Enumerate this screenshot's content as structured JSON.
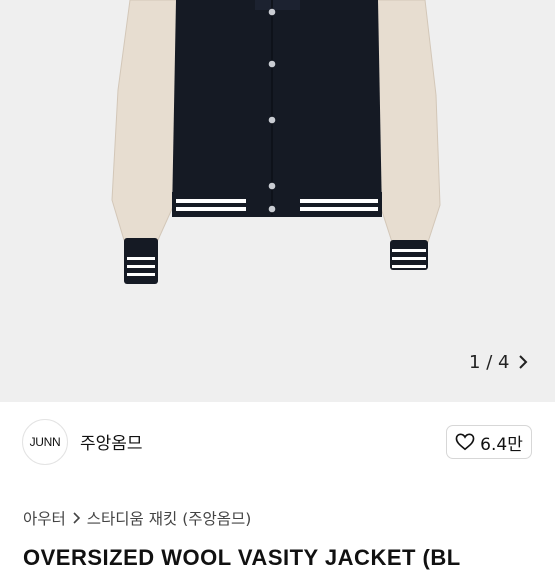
{
  "gallery": {
    "pager": {
      "current": "1",
      "separator": "/",
      "total": "4"
    }
  },
  "seller": {
    "logo_text": "JUNN",
    "name": "주앙옴므",
    "likes": "6.4만"
  },
  "breadcrumb": {
    "category": "아우터",
    "subcategory": "스타디움 재킷 (주앙옴므)"
  },
  "product": {
    "title": "OVERSIZED WOOL VASITY JACKET (BL"
  },
  "colors": {
    "background": "#ffffff",
    "gallery_bg": "#efefef",
    "jacket_body": "#151a24",
    "jacket_sleeve": "#e7ddd0"
  },
  "icons": {
    "pager_next": "chevron-right-icon",
    "like": "heart-outline-icon",
    "breadcrumb_separator": "chevron-right-icon"
  }
}
